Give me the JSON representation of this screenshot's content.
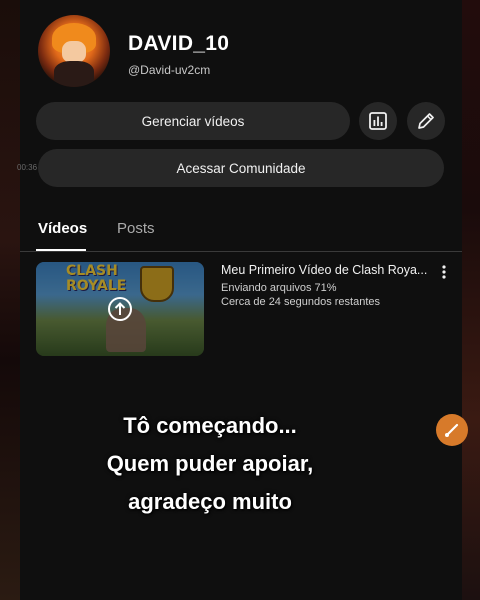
{
  "channel": {
    "name": "DAVID_10",
    "handle": "@David-uv2cm"
  },
  "actions": {
    "manage_label": "Gerenciar vídeos",
    "community_label": "Acessar Comunidade"
  },
  "recording_time": "00:36",
  "tabs": [
    {
      "label": "Vídeos",
      "active": true
    },
    {
      "label": "Posts",
      "active": false
    }
  ],
  "upload": {
    "title": "Meu Primeiro Vídeo de Clash Roya...",
    "status": "Enviando arquivos 71%",
    "remaining": "Cerca de 24 segundos restantes",
    "progress": 0.71,
    "thumb_text": "CLASH ROYALE"
  },
  "caption": {
    "line1": "Tô começando...",
    "line2": "Quem puder apoiar,",
    "line3": "agradeço muito"
  },
  "colors": {
    "background": "#0f0f0f",
    "button": "#272727",
    "accent_fab": "#d77a2a"
  },
  "icons": [
    "analytics-icon",
    "edit-pencil-icon",
    "upload-arrow-icon",
    "more-vertical-icon",
    "brush-icon"
  ]
}
